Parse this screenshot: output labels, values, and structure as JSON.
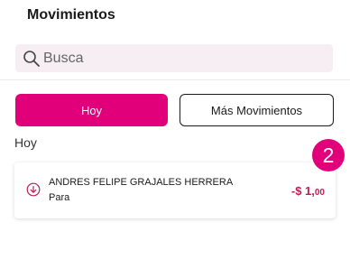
{
  "header": {
    "title": "Movimientos"
  },
  "search": {
    "placeholder": "Busca"
  },
  "tabs": [
    {
      "label": "Hoy",
      "active": true
    },
    {
      "label": "Más Movimientos",
      "active": false
    }
  ],
  "section": {
    "label": "Hoy"
  },
  "badge": {
    "value": "2"
  },
  "transactions": [
    {
      "name": "ANDRES FELIPE GRAJALES HERRERA",
      "subtitle": "Para",
      "amount_main": "-$ 1,",
      "amount_cents": "00",
      "direction_icon": "arrow-down-circle-icon"
    }
  ],
  "colors": {
    "accent": "#e2007a",
    "amount_negative": "#c41c52",
    "search_bg": "#f6eef3"
  }
}
